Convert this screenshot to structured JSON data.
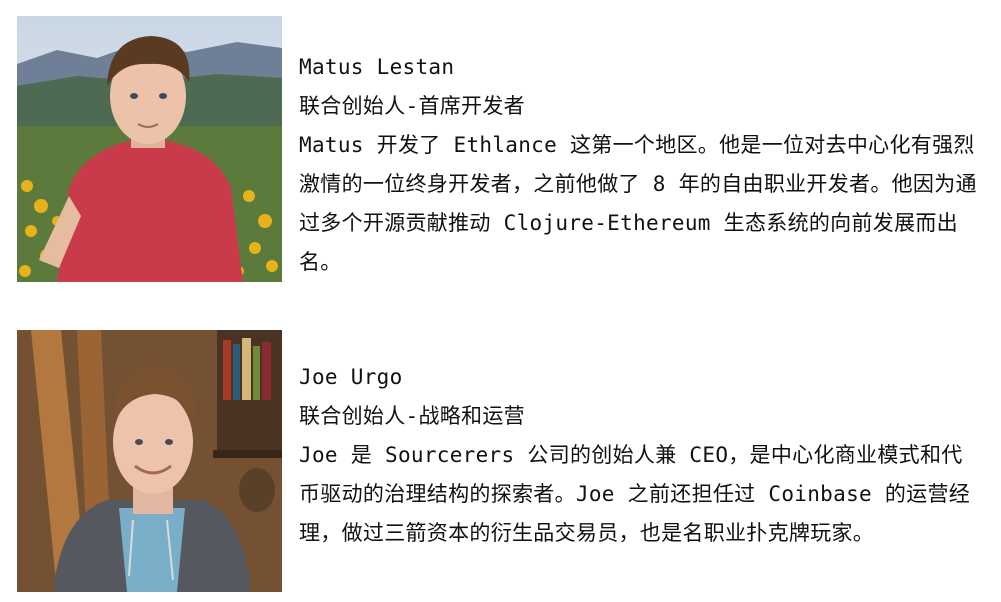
{
  "people": [
    {
      "name": "Matus Lestan",
      "role": "联合创始人-首席开发者",
      "bio": "Matus 开发了 Ethlance 这第一个地区。他是一位对去中心化有强烈激情的一位终身开发者，之前他做了 8 年的自由职业开发者。他因为通过多个开源贡献推动 Clojure-Ethereum 生态系统的向前发展而出名。"
    },
    {
      "name": "Joe Urgo",
      "role": "联合创始人-战略和运营",
      "bio": "Joe 是 Sourcerers 公司的创始人兼 CEO，是中心化商业模式和代币驱动的治理结构的探索者。Joe 之前还担任过 Coinbase 的运营经理，做过三箭资本的衍生品交易员，也是名职业扑克牌玩家。"
    }
  ]
}
